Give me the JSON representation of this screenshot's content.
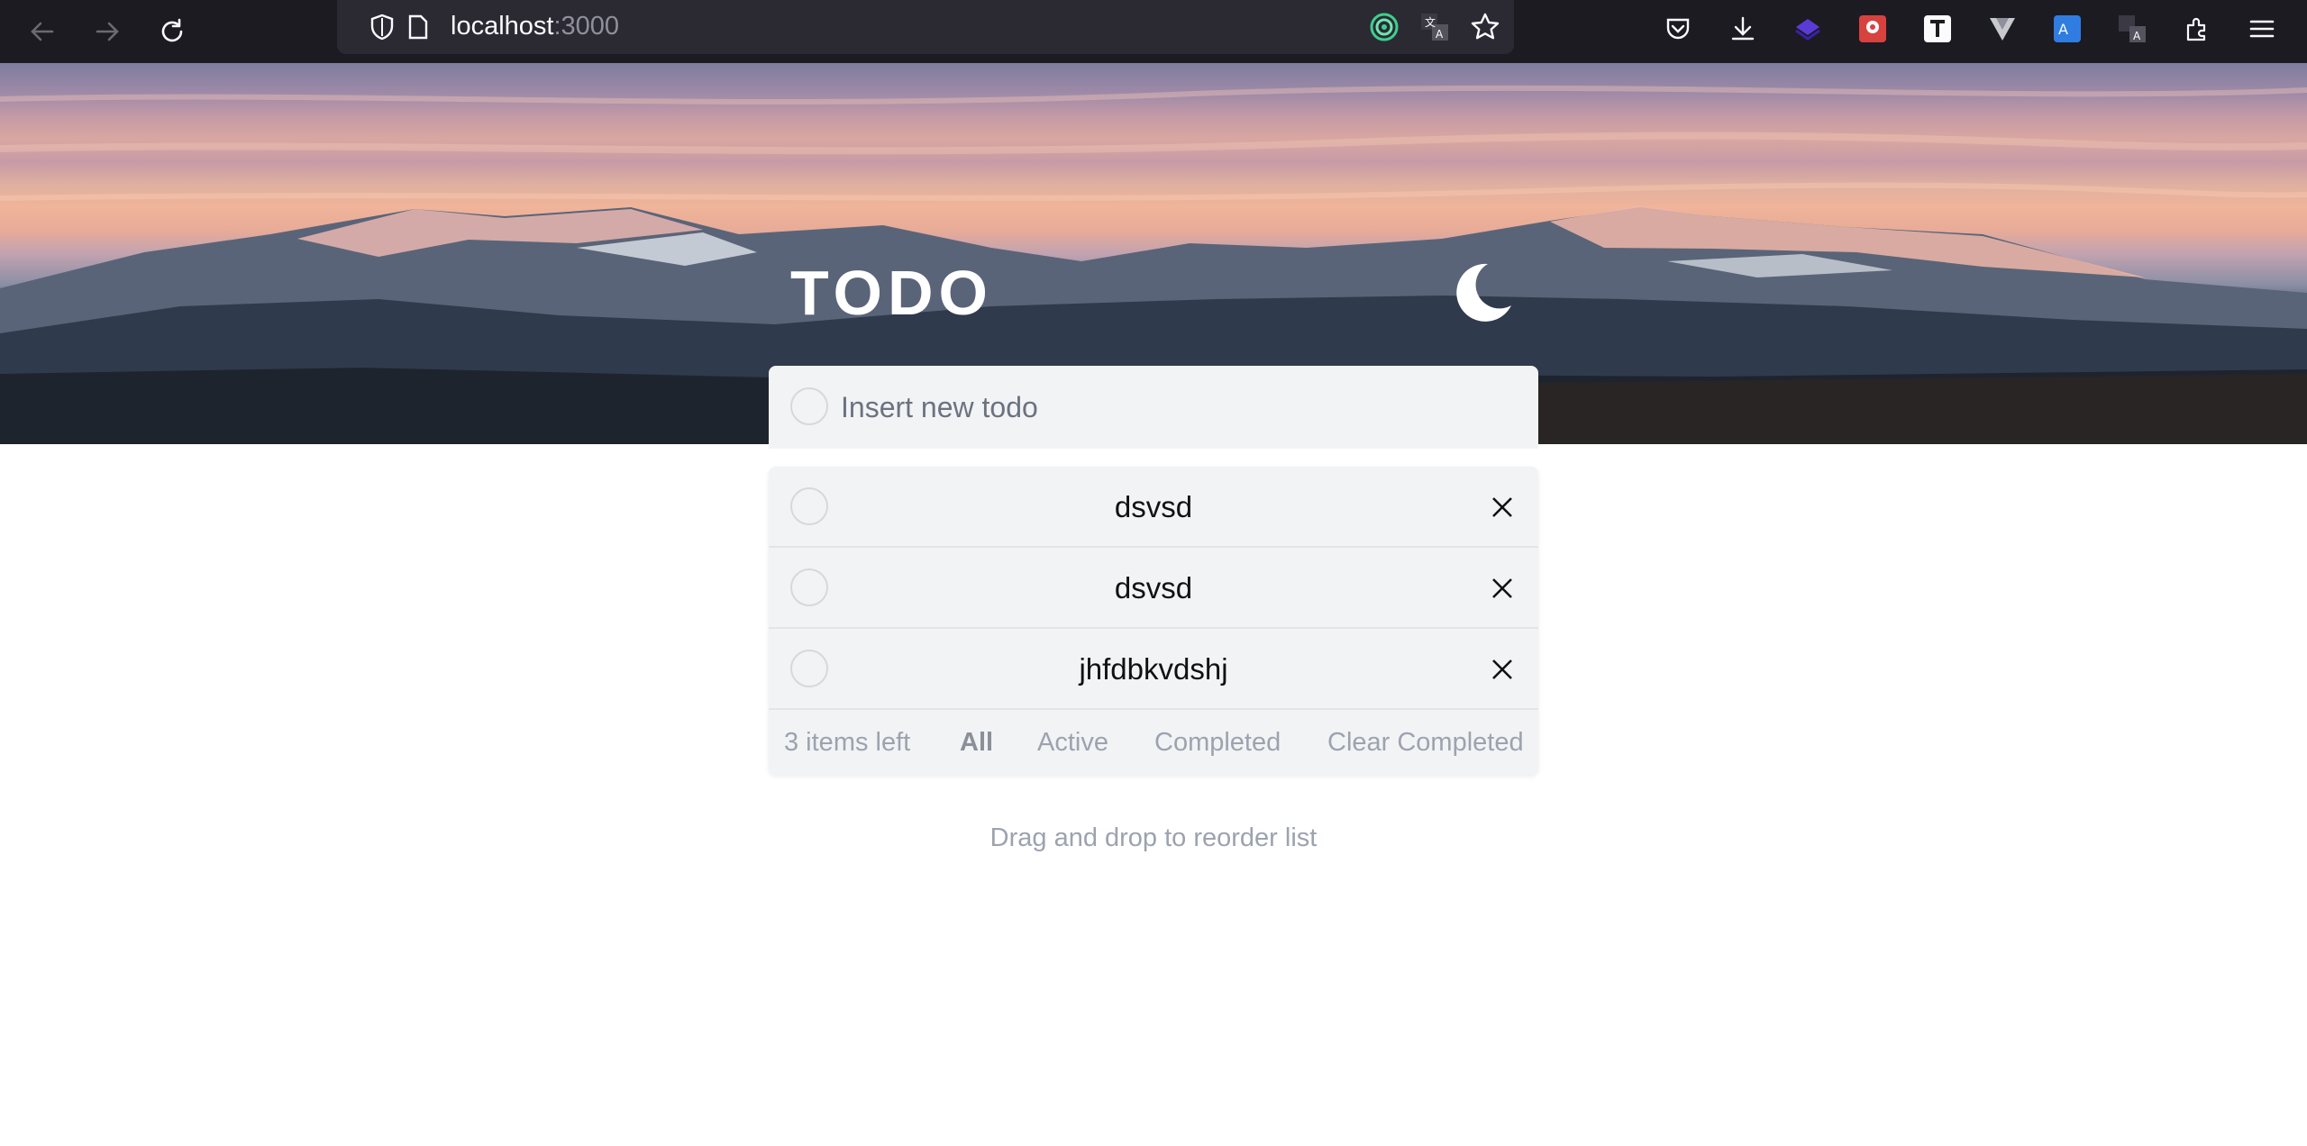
{
  "browser": {
    "url_host": "localhost",
    "url_port": ":3000"
  },
  "app": {
    "title": "TODO",
    "new_todo_placeholder": "Insert new todo"
  },
  "todos": [
    {
      "text": "dsvsd",
      "completed": false
    },
    {
      "text": "dsvsd",
      "completed": false
    },
    {
      "text": "jhfdbkvdshj",
      "completed": false
    }
  ],
  "footer": {
    "items_left": "3 items left",
    "filter_all": "All",
    "filter_active": "Active",
    "filter_completed": "Completed",
    "clear_completed": "Clear Completed"
  },
  "hint": "Drag and drop to reorder list",
  "colors": {
    "card_bg": "#f2f3f5",
    "muted_text": "#9ca3af",
    "chrome_bg": "#1c1b22"
  }
}
